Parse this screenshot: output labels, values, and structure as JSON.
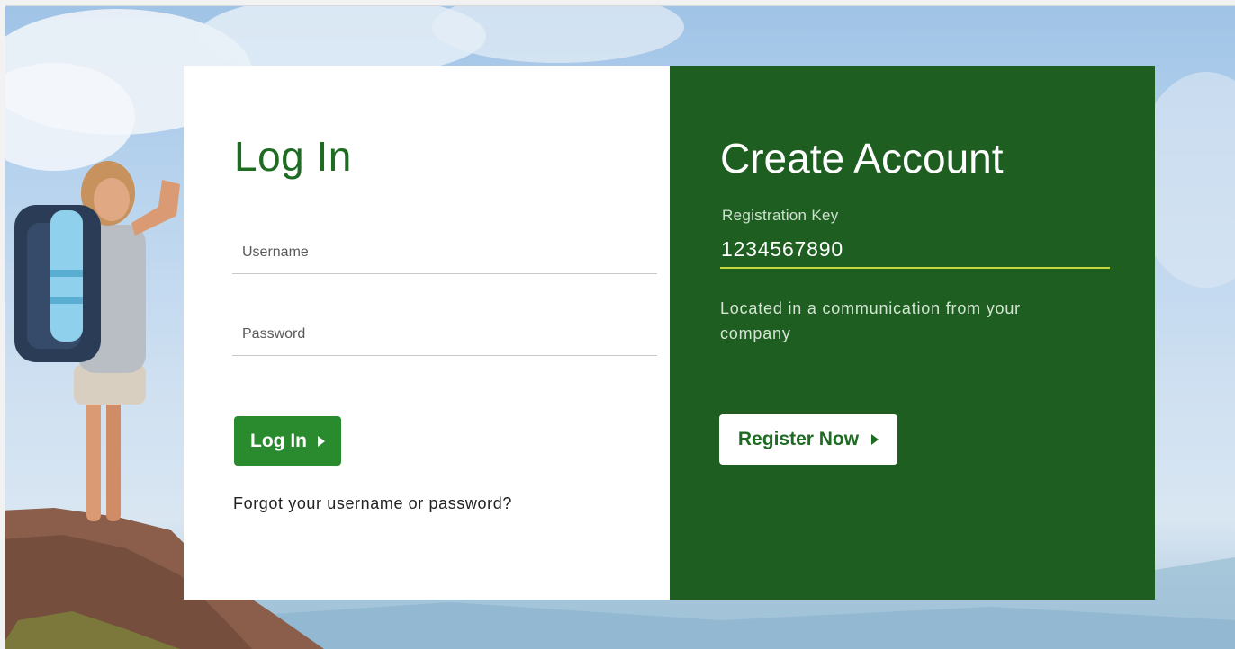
{
  "login": {
    "title": "Log In",
    "username_placeholder": "Username",
    "password_placeholder": "Password",
    "button_label": "Log In",
    "forgot_label": "Forgot your username or password?"
  },
  "register": {
    "title": "Create Account",
    "key_label": "Registration Key",
    "key_value": "1234567890",
    "help_text": "Located in a communication from your company",
    "button_label": "Register Now"
  },
  "colors": {
    "brand_green": "#1e6b22",
    "panel_green": "#1e5e20",
    "button_green": "#2a8a2e",
    "focus_underline": "#c7d63a"
  },
  "icons": {
    "button_arrow": "caret-right-icon"
  }
}
